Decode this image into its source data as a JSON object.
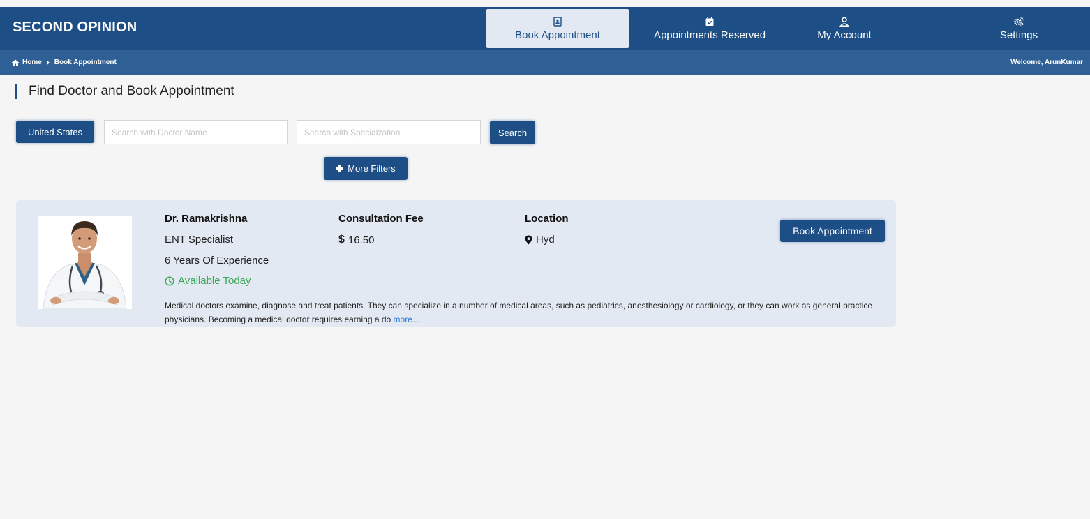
{
  "brand": "SECOND OPINION",
  "nav": {
    "book": "Book Appointment",
    "reserved": "Appointments Reserved",
    "account": "My Account",
    "settings": "Settings"
  },
  "breadcrumb": {
    "home": "Home",
    "current": "Book Appointment"
  },
  "welcome": "Welcome, ArunKumar",
  "page_title": "Find Doctor and Book Appointment",
  "filters": {
    "country": "United States",
    "doctor_placeholder": "Search with Doctor Name",
    "spec_placeholder": "Search with Specialzation",
    "search": "Search",
    "more_filters": "More Filters"
  },
  "doctor": {
    "name": "Dr. Ramakrishna",
    "specialty": "ENT Specialist",
    "experience": "6 Years Of Experience",
    "availability": "Available Today",
    "fee_label": "Consultation Fee",
    "fee_currency": "$",
    "fee_value": "16.50",
    "location_label": "Location",
    "location": "Hyd",
    "book_button": "Book Appointment",
    "description": "Medical doctors examine, diagnose and treat patients. They can specialize in a number of medical areas, such as pediatrics, anesthesiology or cardiology, or they can work as general practice physicians. Becoming a medical doctor requires earning a do",
    "more_link": "more..."
  },
  "icons": {
    "nav_book": "contact-card-icon",
    "nav_reserved": "calendar-check-icon",
    "nav_account": "user-icon",
    "nav_settings": "gears-icon",
    "home": "home-icon",
    "breadcrumb_sep": "caret-right-icon",
    "availability": "clock-icon",
    "location": "map-marker-icon",
    "more_filters": "plus-icon"
  },
  "colors": {
    "header": "#1d4e85",
    "subheader": "#2e5f95",
    "card": "#e3e9f2",
    "available": "#3aa856",
    "link": "#2b7be0"
  }
}
